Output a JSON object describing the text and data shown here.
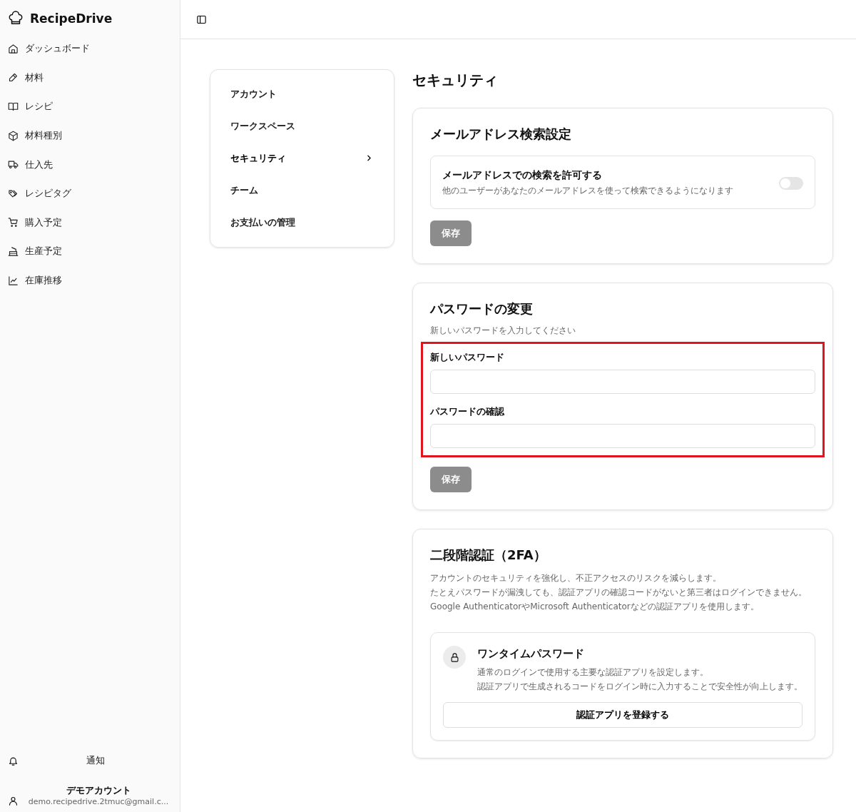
{
  "sidebar": {
    "brand": "RecipeDrive",
    "items": [
      {
        "label": "ダッシュボード"
      },
      {
        "label": "材料"
      },
      {
        "label": "レシピ"
      },
      {
        "label": "材料種別"
      },
      {
        "label": "仕入先"
      },
      {
        "label": "レシピタグ"
      },
      {
        "label": "購入予定"
      },
      {
        "label": "生産予定"
      },
      {
        "label": "在庫推移"
      }
    ],
    "notifications": "通知",
    "account": {
      "name": "デモアカウント",
      "email": "demo.recipedrive.2tmuc@gmail.c..."
    }
  },
  "settings_nav": [
    {
      "label": "アカウント",
      "selected": false
    },
    {
      "label": "ワークスペース",
      "selected": false
    },
    {
      "label": "セキュリティ",
      "selected": true
    },
    {
      "label": "チーム",
      "selected": false
    },
    {
      "label": "お支払いの管理",
      "selected": false
    }
  ],
  "page_title": "セキュリティ",
  "email_search": {
    "title": "メールアドレス検索設定",
    "option_title": "メールアドレスでの検索を許可する",
    "option_description": "他のユーザーがあなたのメールアドレスを使って検索できるようになります",
    "on": false,
    "save": "保存",
    "save_disabled": true
  },
  "password": {
    "title": "パスワードの変更",
    "description": "新しいパスワードを入力してください",
    "highlighted": true,
    "fields": [
      {
        "label": "新しいパスワード"
      },
      {
        "label": "パスワードの確認"
      }
    ],
    "save": "保存",
    "save_disabled": true
  },
  "two_factor": {
    "title": "二段階認証（2FA）",
    "description": [
      "アカウントのセキュリティを強化し、不正アクセスのリスクを減らします。",
      "たとえパスワードが漏洩しても、認証アプリの確認コードがないと第三者はログインできません。",
      "Google AuthenticatorやMicrosoft Authenticatorなどの認証アプリを使用します。"
    ],
    "method": {
      "title": "ワンタイムパスワード",
      "description": [
        "通常のログインで使用する主要な認証アプリを設定します。",
        "認証アプリで生成されるコードをログイン時に入力することで安全性が向上します。"
      ],
      "button": "認証アプリを登録する"
    }
  }
}
